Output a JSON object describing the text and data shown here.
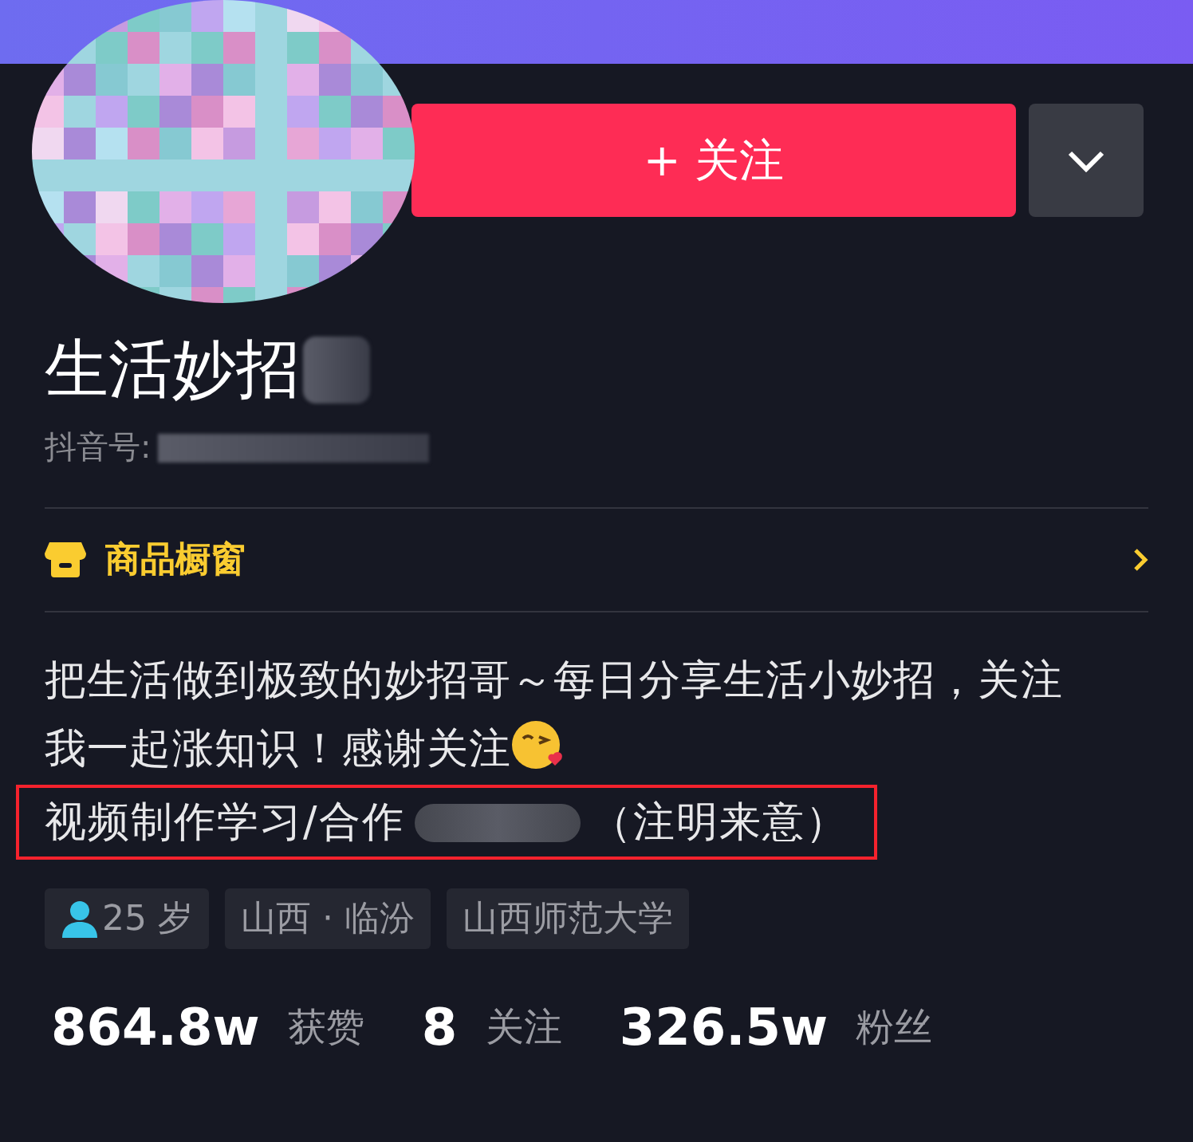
{
  "header": {
    "follow_button": "+ 关注"
  },
  "profile": {
    "name": "生活妙招",
    "id_label": "抖音号:"
  },
  "shop": {
    "label": "商品橱窗"
  },
  "bio": {
    "lines": [
      "把生活做到极致的妙招哥～每日分享生活小妙招，关注",
      "我一起涨知识！感谢关注"
    ],
    "contact": {
      "label": "视频制作学习/合作",
      "note": "（注明来意）",
      "highlighted": true
    }
  },
  "tags": [
    {
      "kind": "age",
      "text": "25 岁"
    },
    {
      "kind": "plain",
      "text": "山西 · 临汾"
    },
    {
      "kind": "plain",
      "text": "山西师范大学"
    }
  ],
  "stats": [
    "**864.8w** 获赞",
    "**8** 关注",
    "**326.5w** 粉丝"
  ]
}
